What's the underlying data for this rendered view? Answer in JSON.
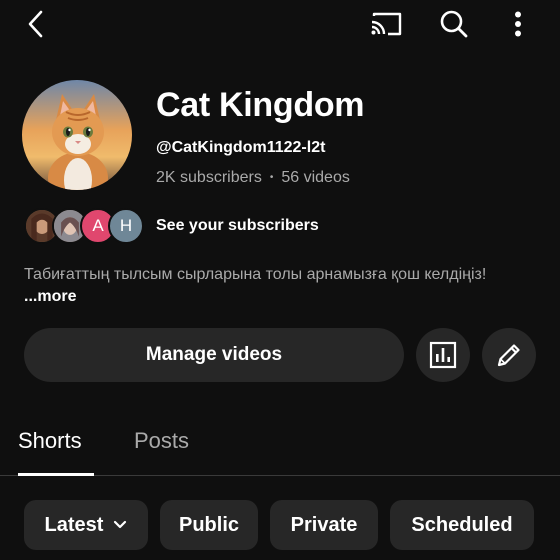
{
  "topbar": {
    "icons": [
      "back-icon",
      "cast-icon",
      "search-icon",
      "more-vertical-icon"
    ]
  },
  "channel": {
    "name": "Cat Kingdom",
    "handle": "@CatKingdom1122-l2t",
    "subscribers": "2K subscribers",
    "dot": "•",
    "videos": "56 videos",
    "avatar_icon": "cat-avatar"
  },
  "subscribers_row": {
    "label": "See your subscribers",
    "avatars": [
      {
        "type": "photo",
        "color": "#7a5a3c"
      },
      {
        "type": "photo",
        "color": "#9a8a86"
      },
      {
        "type": "letter",
        "letter": "A",
        "color": "#e0476e"
      },
      {
        "type": "letter",
        "letter": "H",
        "color": "#6f8797"
      }
    ]
  },
  "description": {
    "text": "Табиғаттың тылсым сырларына толы арнамызға қош келдіңіз!",
    "more": "...more"
  },
  "actions": {
    "manage_label": "Manage videos",
    "analytics_icon": "analytics-icon",
    "edit_icon": "edit-pencil-icon"
  },
  "tabs": [
    {
      "label": "Shorts",
      "active": true
    },
    {
      "label": "Posts",
      "active": false
    }
  ],
  "chips": {
    "latest": "Latest",
    "public": "Public",
    "private": "Private",
    "scheduled": "Scheduled"
  },
  "colors": {
    "background": "#0f0f0f",
    "surface": "#272727",
    "text_primary": "#ffffff",
    "text_secondary": "#aaaaaa"
  }
}
